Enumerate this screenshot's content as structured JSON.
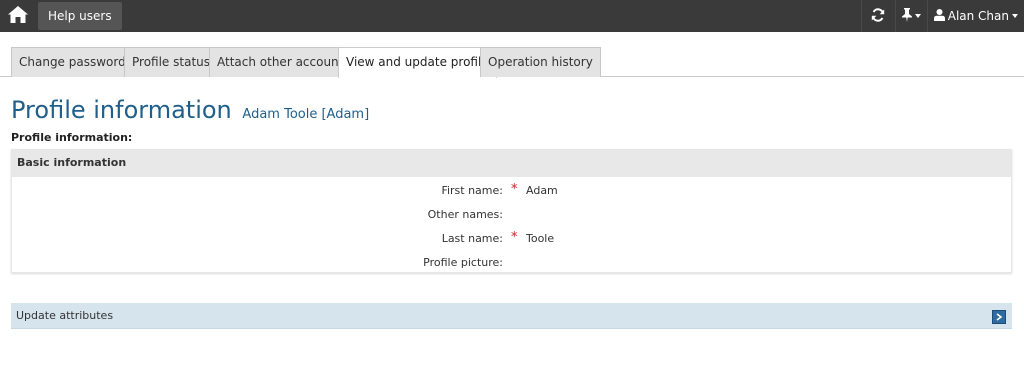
{
  "topbar": {
    "home_icon": "home-icon",
    "app_label": "Help users",
    "refresh_icon": "refresh-icon",
    "pin_icon": "pin-icon",
    "user_icon": "user-icon",
    "user_name": "Alan Chan",
    "background": "#3a3a3a"
  },
  "tabs": [
    {
      "label": "Change passwords",
      "active": false
    },
    {
      "label": "Profile status",
      "active": false
    },
    {
      "label": "Attach other accounts",
      "active": false
    },
    {
      "label": "View and update profile",
      "active": true
    },
    {
      "label": "Operation history",
      "active": false
    }
  ],
  "page": {
    "title": "Profile information",
    "subtitle": "Adam Toole [Adam]",
    "section_label": "Profile information:"
  },
  "panel": {
    "header": "Basic information",
    "fields": [
      {
        "label": "First name:",
        "required": true,
        "value": "Adam"
      },
      {
        "label": "Other names:",
        "required": false,
        "value": ""
      },
      {
        "label": "Last name:",
        "required": true,
        "value": "Toole"
      },
      {
        "label": "Profile picture:",
        "required": false,
        "value": ""
      }
    ],
    "required_marker": "*"
  },
  "attributes": {
    "label": "Update attributes",
    "expand_icon": "chevron-right-icon"
  },
  "colors": {
    "accent": "#1f5f8a",
    "required": "#c42020",
    "attr_bar": "#d6e4ee"
  }
}
